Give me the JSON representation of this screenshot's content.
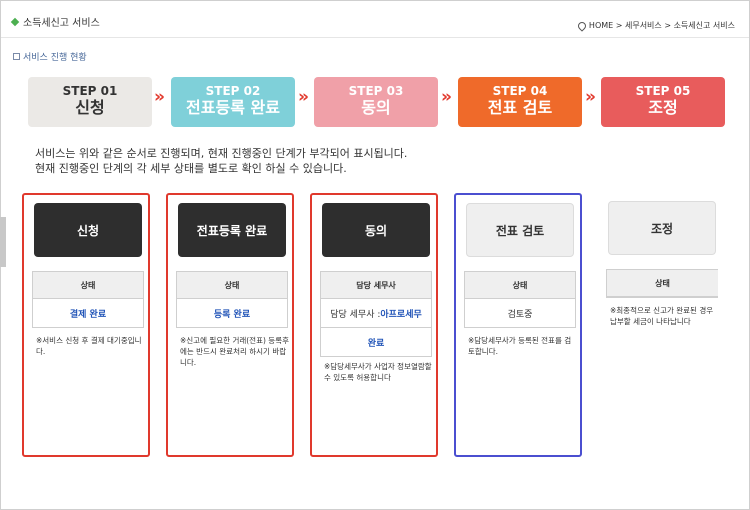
{
  "header": {
    "app_title": "소득세신고 서비스",
    "breadcrumb": "HOME > 세무서비스 > 소득세신고 서비스"
  },
  "section": {
    "title": "서비스 진행 현황"
  },
  "steps": [
    {
      "num": "STEP 01",
      "name": "신청",
      "bg": "#ebe9e6",
      "color": "#333333"
    },
    {
      "num": "STEP 02",
      "name": "전표등록 완료",
      "bg": "#7fd0d9",
      "color": "#ffffff"
    },
    {
      "num": "STEP 03",
      "name": "동의",
      "bg": "#f0a0a8",
      "color": "#ffffff"
    },
    {
      "num": "STEP 04",
      "name": "전표 검토",
      "bg": "#ef6a2a",
      "color": "#ffffff"
    },
    {
      "num": "STEP 05",
      "name": "조정",
      "bg": "#e85c5c",
      "color": "#ffffff"
    }
  ],
  "arrow_glyph": "»",
  "description": {
    "line1": "서비스는 위와 같은 순서로 진행되며, 현재 진행중인 단계가 부각되어 표시됩니다.",
    "line2": "현재 진행중인 단계의 각 세부 상태를 별도로 확인 하실 수 있습니다."
  },
  "cards": [
    {
      "title": "신청",
      "status_label": "상태",
      "status_value": "결제 완료",
      "note": "※서비스 신청 후 결제 대기중입니다."
    },
    {
      "title": "전표등록 완료",
      "status_label": "상태",
      "status_value": "등록 완료",
      "note": "※신고에 필요한 거래(전표) 등록후에는 반드시 완료처리 하시기 바랍니다."
    },
    {
      "title": "동의",
      "status_label": "담당 세무사",
      "tax_accountant_label": "담당 세무사 : ",
      "tax_accountant_name": "아프로세무",
      "status_value": "완료",
      "note": "※담당세무사가 사업자 정보열람할 수 있도록 허용합니다"
    },
    {
      "title": "전표 검토",
      "status_label": "상태",
      "status_value": "검토중",
      "note": "※담당세무사가 등록된 전표를 검토합니다."
    },
    {
      "title": "조정",
      "status_label": "상태",
      "note": "※최종적으로 신고가 완료된 경우 납부할 세금이 나타납니다"
    }
  ],
  "colors": {
    "active_border": "#e0392d",
    "current_border": "#4b4fd0",
    "arrow": "#e23a2e",
    "link_blue": "#2255b8"
  }
}
